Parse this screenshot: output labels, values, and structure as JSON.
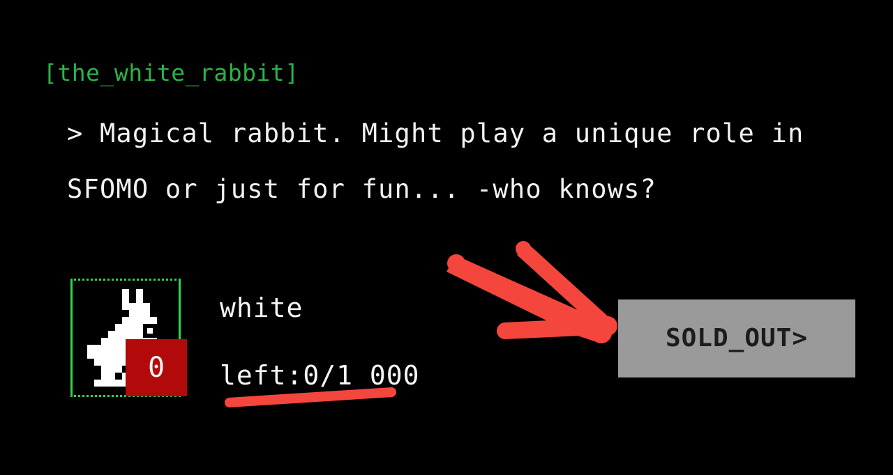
{
  "theme": {
    "background": "#000000",
    "title_green": "#2ab34a",
    "frame_green": "#2fd44d",
    "body_text": "#f2f2f2",
    "badge_red": "#b20a0a",
    "annotation_red": "#f4463c",
    "button_gray": "#9a9a9a",
    "button_text": "#1c1c1c"
  },
  "card": {
    "title": "[the_white_rabbit]",
    "description": "> Magical rabbit. Might play a unique role in SFOMO or just for fun... -who knows?",
    "thumbnail": {
      "icon": "pixel-rabbit-icon",
      "alt": "white pixel-art rabbit"
    },
    "count_badge": "0",
    "item_name": "white",
    "stock_label": "left:0/1 000",
    "action_button": "SOLD_OUT>"
  },
  "annotations": [
    {
      "name": "arrow-pointing-to-sold-out-button",
      "shape": "hand-drawn-arrow",
      "color": "#f4463c"
    },
    {
      "name": "underline-under-stock-label",
      "shape": "hand-drawn-underline",
      "color": "#f4463c"
    }
  ]
}
